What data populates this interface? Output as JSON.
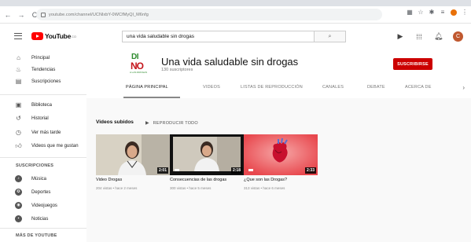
{
  "browser": {
    "url": "youtube.com/channel/UCNlxbY-0WCfMyQl_M6nfg",
    "nav": {
      "back": "←",
      "forward": "→",
      "reload": "C"
    }
  },
  "header": {
    "logo_text": "YouTube",
    "logo_sup": "CO",
    "search_value": "una vida saludable sin drogas",
    "search_icon": "search-icon",
    "avatar_letter": "C"
  },
  "sidebar": {
    "main": [
      {
        "label": "Principal",
        "icon": "home-icon"
      },
      {
        "label": "Tendencias",
        "icon": "fire-icon"
      },
      {
        "label": "Suscripciones",
        "icon": "subscriptions-icon"
      }
    ],
    "library": [
      {
        "label": "Biblioteca",
        "icon": "library-icon"
      },
      {
        "label": "Historial",
        "icon": "history-icon"
      },
      {
        "label": "Ver más tarde",
        "icon": "clock-icon"
      },
      {
        "label": "Videos que me gustan",
        "icon": "thumbs-up-icon"
      }
    ],
    "subs_heading": "SUSCRIPCIONES",
    "subs": [
      {
        "label": "Música",
        "icon": "music-icon"
      },
      {
        "label": "Deportes",
        "icon": "sports-icon"
      },
      {
        "label": "Videojuegos",
        "icon": "gaming-icon"
      },
      {
        "label": "Noticias",
        "icon": "news-icon"
      }
    ],
    "more_heading": "MÁS DE YOUTUBE"
  },
  "channel": {
    "logo_line1": "DI",
    "logo_line2": "NO",
    "logo_line3": "A LAS DROGAS",
    "title": "Una vida saludable sin drogas",
    "subscribers": "130 suscriptores",
    "subscribe_label": "SUSCRIBIRSE",
    "tabs": [
      "PÁGINA PRINCIPAL",
      "VIDEOS",
      "LISTAS DE REPRODUCCIÓN",
      "CANALES",
      "DEBATE",
      "ACERCA DE"
    ],
    "active_tab": "PÁGINA PRINCIPAL"
  },
  "uploads": {
    "section_title": "Videos subidos",
    "play_all": "REPRODUCIR TODO",
    "videos": [
      {
        "title": "Video Drogas",
        "meta": "204 vistas • hace 2 meses",
        "duration": "2:01"
      },
      {
        "title": "Consecuencias de las drogas",
        "meta": "300 vistas • hace 5 meses",
        "duration": "2:18"
      },
      {
        "title": "¿Que son las Drogas?",
        "meta": "313 vistas • hace 6 meses",
        "duration": "2:33"
      }
    ]
  },
  "colors": {
    "brand_red": "#ff0000",
    "subscribe_red": "#cc0000",
    "content_bg": "#f9f9f9"
  }
}
